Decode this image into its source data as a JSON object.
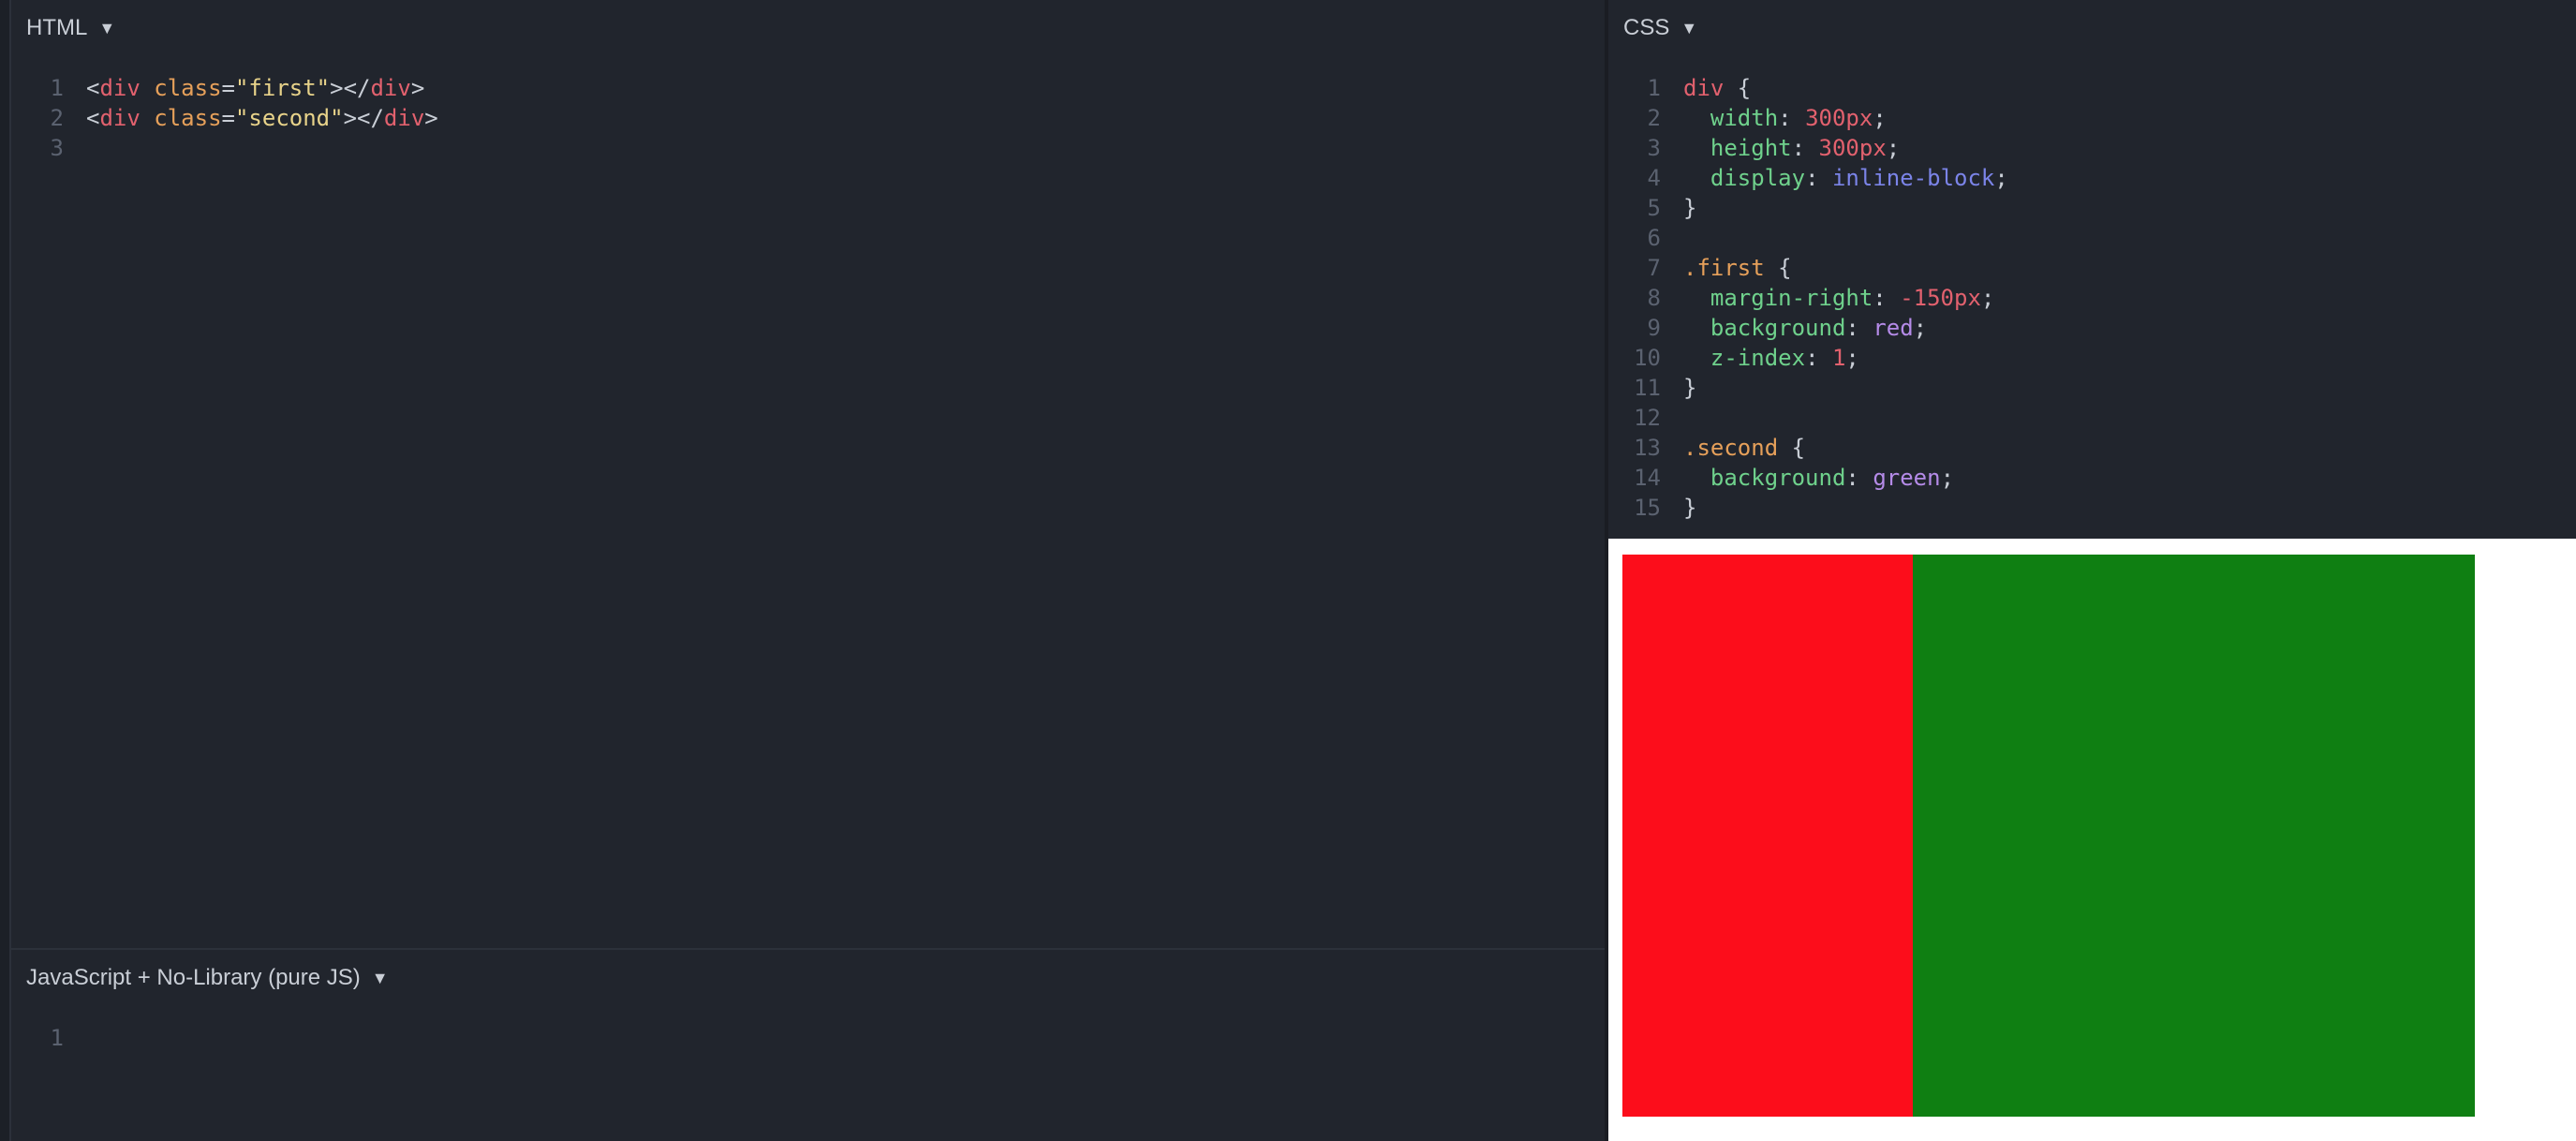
{
  "html_pane": {
    "title": "HTML",
    "lines": [
      [
        {
          "t": "<",
          "c": "punc"
        },
        {
          "t": "div",
          "c": "tag"
        },
        {
          "t": " ",
          "c": "txt"
        },
        {
          "t": "class",
          "c": "attr"
        },
        {
          "t": "=",
          "c": "punc"
        },
        {
          "t": "\"first\"",
          "c": "str"
        },
        {
          "t": ">",
          "c": "punc"
        },
        {
          "t": "</",
          "c": "punc"
        },
        {
          "t": "div",
          "c": "tag"
        },
        {
          "t": ">",
          "c": "punc"
        }
      ],
      [
        {
          "t": "<",
          "c": "punc"
        },
        {
          "t": "div",
          "c": "tag"
        },
        {
          "t": " ",
          "c": "txt"
        },
        {
          "t": "class",
          "c": "attr"
        },
        {
          "t": "=",
          "c": "punc"
        },
        {
          "t": "\"second\"",
          "c": "str"
        },
        {
          "t": ">",
          "c": "punc"
        },
        {
          "t": "</",
          "c": "punc"
        },
        {
          "t": "div",
          "c": "tag"
        },
        {
          "t": ">",
          "c": "punc"
        }
      ],
      []
    ]
  },
  "css_pane": {
    "title": "CSS",
    "lines": [
      [
        {
          "t": "div",
          "c": "sel"
        },
        {
          "t": " {",
          "c": "punc"
        }
      ],
      [
        {
          "t": "  ",
          "c": "txt"
        },
        {
          "t": "width",
          "c": "prop"
        },
        {
          "t": ": ",
          "c": "punc"
        },
        {
          "t": "300px",
          "c": "num"
        },
        {
          "t": ";",
          "c": "punc"
        }
      ],
      [
        {
          "t": "  ",
          "c": "txt"
        },
        {
          "t": "height",
          "c": "prop"
        },
        {
          "t": ": ",
          "c": "punc"
        },
        {
          "t": "300px",
          "c": "num"
        },
        {
          "t": ";",
          "c": "punc"
        }
      ],
      [
        {
          "t": "  ",
          "c": "txt"
        },
        {
          "t": "display",
          "c": "prop"
        },
        {
          "t": ": ",
          "c": "punc"
        },
        {
          "t": "inline-block",
          "c": "kw"
        },
        {
          "t": ";",
          "c": "punc"
        }
      ],
      [
        {
          "t": "}",
          "c": "punc"
        }
      ],
      [],
      [
        {
          "t": ".first",
          "c": "cls"
        },
        {
          "t": " {",
          "c": "punc"
        }
      ],
      [
        {
          "t": "  ",
          "c": "txt"
        },
        {
          "t": "margin-right",
          "c": "prop"
        },
        {
          "t": ": ",
          "c": "punc"
        },
        {
          "t": "-150px",
          "c": "num"
        },
        {
          "t": ";",
          "c": "punc"
        }
      ],
      [
        {
          "t": "  ",
          "c": "txt"
        },
        {
          "t": "background",
          "c": "prop"
        },
        {
          "t": ": ",
          "c": "punc"
        },
        {
          "t": "red",
          "c": "col"
        },
        {
          "t": ";",
          "c": "punc"
        }
      ],
      [
        {
          "t": "  ",
          "c": "txt"
        },
        {
          "t": "z-index",
          "c": "prop"
        },
        {
          "t": ": ",
          "c": "punc"
        },
        {
          "t": "1",
          "c": "num"
        },
        {
          "t": ";",
          "c": "punc"
        }
      ],
      [
        {
          "t": "}",
          "c": "punc"
        }
      ],
      [],
      [
        {
          "t": ".second",
          "c": "cls"
        },
        {
          "t": " {",
          "c": "punc"
        }
      ],
      [
        {
          "t": "  ",
          "c": "txt"
        },
        {
          "t": "background",
          "c": "prop"
        },
        {
          "t": ": ",
          "c": "punc"
        },
        {
          "t": "green",
          "c": "col"
        },
        {
          "t": ";",
          "c": "punc"
        }
      ],
      [
        {
          "t": "}",
          "c": "punc"
        }
      ]
    ]
  },
  "js_pane": {
    "title": "JavaScript + No-Library (pure JS)",
    "lines": [
      []
    ]
  },
  "preview": {
    "background": "#ffffff",
    "first_color": "#fc0d1b",
    "second_color": "#0f7f12"
  },
  "icons": {
    "dropdown": "caret-down-icon"
  }
}
